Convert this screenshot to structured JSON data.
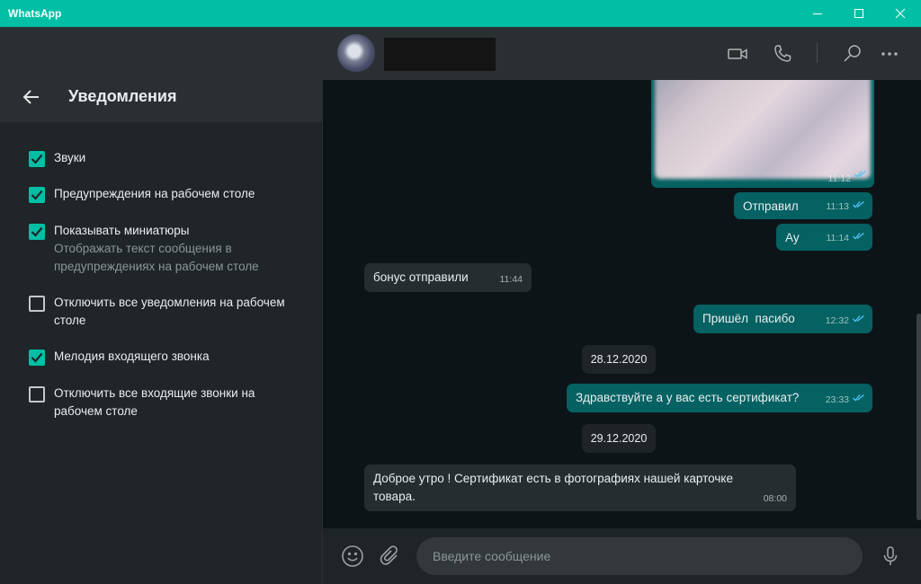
{
  "window": {
    "title": "WhatsApp"
  },
  "settings": {
    "title": "Уведомления",
    "options": [
      {
        "label": "Звуки",
        "checked": true
      },
      {
        "label": "Предупреждения на рабочем столе",
        "checked": true
      },
      {
        "label": "Показывать миниатюры",
        "description": "Отображать текст сообщения в предупреждениях на рабочем столе",
        "checked": true
      },
      {
        "label": "Отключить все уведомления на рабочем столе",
        "checked": false
      },
      {
        "label": "Мелодия входящего звонка",
        "checked": true
      },
      {
        "label": "Отключить все входящие звонки на рабочем столе",
        "checked": false
      }
    ]
  },
  "chat": {
    "messages": [
      {
        "type": "image",
        "direction": "out",
        "time": "11:12",
        "read": true
      },
      {
        "type": "text",
        "direction": "out",
        "text": "Отправил",
        "time": "11:13",
        "read": true
      },
      {
        "type": "text",
        "direction": "out",
        "text": "Ау",
        "time": "11:14",
        "read": true
      },
      {
        "type": "text",
        "direction": "in",
        "text": "бонус отправили",
        "time": "11:44"
      },
      {
        "type": "text",
        "direction": "out",
        "text": "Пришёл  пасибо",
        "time": "12:32",
        "read": true
      },
      {
        "type": "date",
        "text": "28.12.2020"
      },
      {
        "type": "text",
        "direction": "out",
        "text": "Здравствуйте а у вас есть сертификат?",
        "time": "23:33",
        "read": true
      },
      {
        "type": "date",
        "text": "29.12.2020"
      },
      {
        "type": "text",
        "direction": "in",
        "text": "Доброе утро ! Сертификат есть в фотографиях нашей карточке товара.",
        "time": "08:00"
      }
    ],
    "input_placeholder": "Введите сообщение"
  },
  "colors": {
    "accent": "#00bfa5",
    "outgoing_bubble": "#056162",
    "incoming_bubble": "#262d31",
    "read_ticks": "#4fc3f7"
  },
  "icons": [
    "back-arrow-icon",
    "video-call-icon",
    "phone-icon",
    "search-icon",
    "more-options-icon",
    "emoji-icon",
    "attach-icon",
    "microphone-icon"
  ]
}
